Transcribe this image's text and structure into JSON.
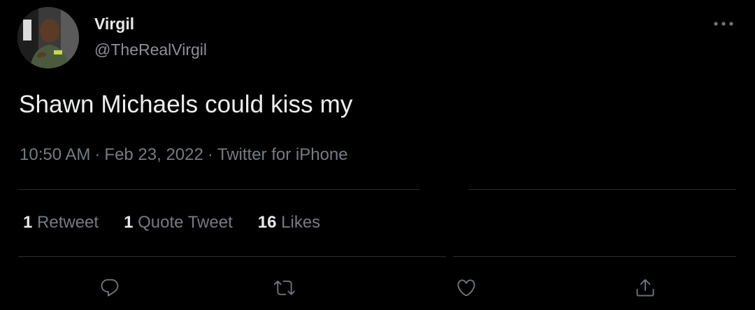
{
  "tweet": {
    "author": {
      "display_name": "Virgil",
      "handle": "@TheRealVirgil",
      "avatar_icon": "user-avatar"
    },
    "text": "Shawn Michaels could kiss my",
    "meta": {
      "time": "10:50 AM",
      "date": "Feb 23, 2022",
      "source": "Twitter for iPhone",
      "separator": "·"
    },
    "stats": {
      "retweets": {
        "count": "1",
        "label": "Retweet"
      },
      "quote_tweets": {
        "count": "1",
        "label": "Quote Tweet"
      },
      "likes": {
        "count": "16",
        "label": "Likes"
      }
    },
    "actions": [
      {
        "name": "reply",
        "icon": "reply-icon"
      },
      {
        "name": "retweet",
        "icon": "retweet-icon"
      },
      {
        "name": "like",
        "icon": "heart-icon"
      },
      {
        "name": "share",
        "icon": "share-icon"
      }
    ],
    "more_icon": "more-icon"
  },
  "colors": {
    "background": "#000000",
    "primary_text": "#e7e9ea",
    "secondary_text": "#757b80",
    "divider": "#2a2d30",
    "icon": "#71767b"
  }
}
